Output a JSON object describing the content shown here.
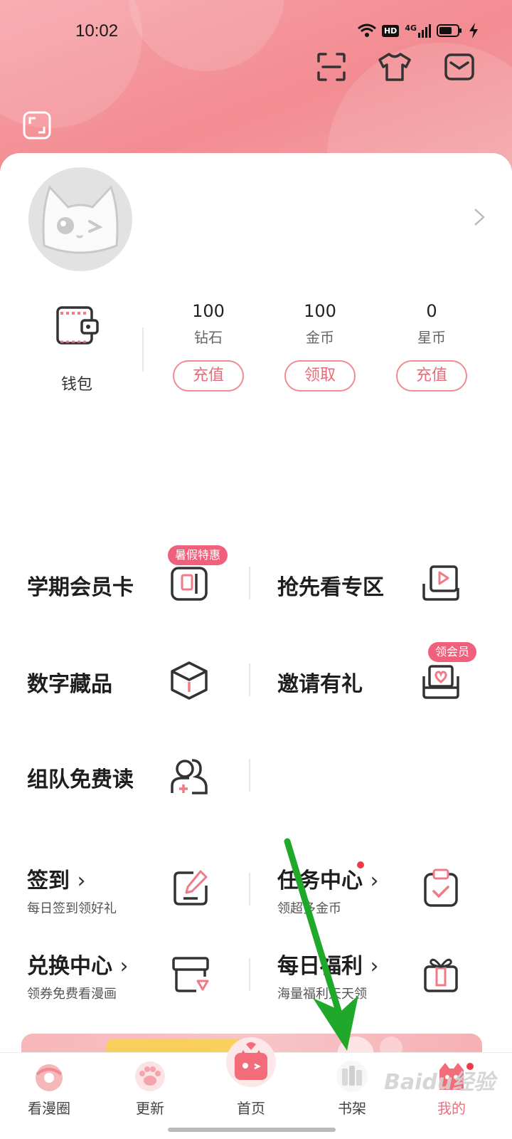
{
  "status_bar": {
    "time": "10:02",
    "hd_label": "HD",
    "network_label": "4G"
  },
  "header": {
    "scan_icon": "scan-icon",
    "skin_icon": "tshirt-icon",
    "message_icon": "mail-icon",
    "expand_icon": "fullscreen-icon"
  },
  "wallet": {
    "label": "钱包",
    "currencies": [
      {
        "amount": "100",
        "name": "钻石",
        "action": "充值"
      },
      {
        "amount": "100",
        "name": "金币",
        "action": "领取"
      },
      {
        "amount": "0",
        "name": "星币",
        "action": "充值"
      }
    ]
  },
  "menu": {
    "items": [
      {
        "label": "学期会员卡",
        "badge": "暑假特惠",
        "icon": "membership-card-icon"
      },
      {
        "label": "抢先看专区",
        "icon": "preview-play-icon"
      },
      {
        "label": "数字藏品",
        "icon": "cube-icon"
      },
      {
        "label": "邀请有礼",
        "badge": "领会员",
        "icon": "invite-envelope-icon"
      },
      {
        "label": "组队免费读",
        "icon": "team-icon"
      }
    ]
  },
  "tasks": [
    {
      "title": "签到",
      "subtitle": "每日签到领好礼",
      "icon": "sign-in-pen-icon"
    },
    {
      "title": "任务中心",
      "subtitle": "领超多金币",
      "icon": "task-clipboard-icon"
    },
    {
      "title": "兑换中心",
      "subtitle": "领券免费看漫画",
      "icon": "exchange-box-icon"
    },
    {
      "title": "每日福利",
      "subtitle": "海量福利天天领",
      "icon": "gift-icon"
    }
  ],
  "tabbar": {
    "tabs": [
      {
        "label": "看漫圈",
        "icon": "donut-icon"
      },
      {
        "label": "更新",
        "icon": "paw-icon"
      },
      {
        "label": "首页",
        "icon": "home-cat-icon"
      },
      {
        "label": "书架",
        "icon": "bookshelf-icon"
      },
      {
        "label": "我的",
        "icon": "profile-cat-icon"
      }
    ]
  },
  "watermark": "Baidu经验",
  "colors": {
    "accent": "#f08b93",
    "header": "#f28c92",
    "badge": "#f0607c",
    "arrow": "#1fa82a"
  }
}
